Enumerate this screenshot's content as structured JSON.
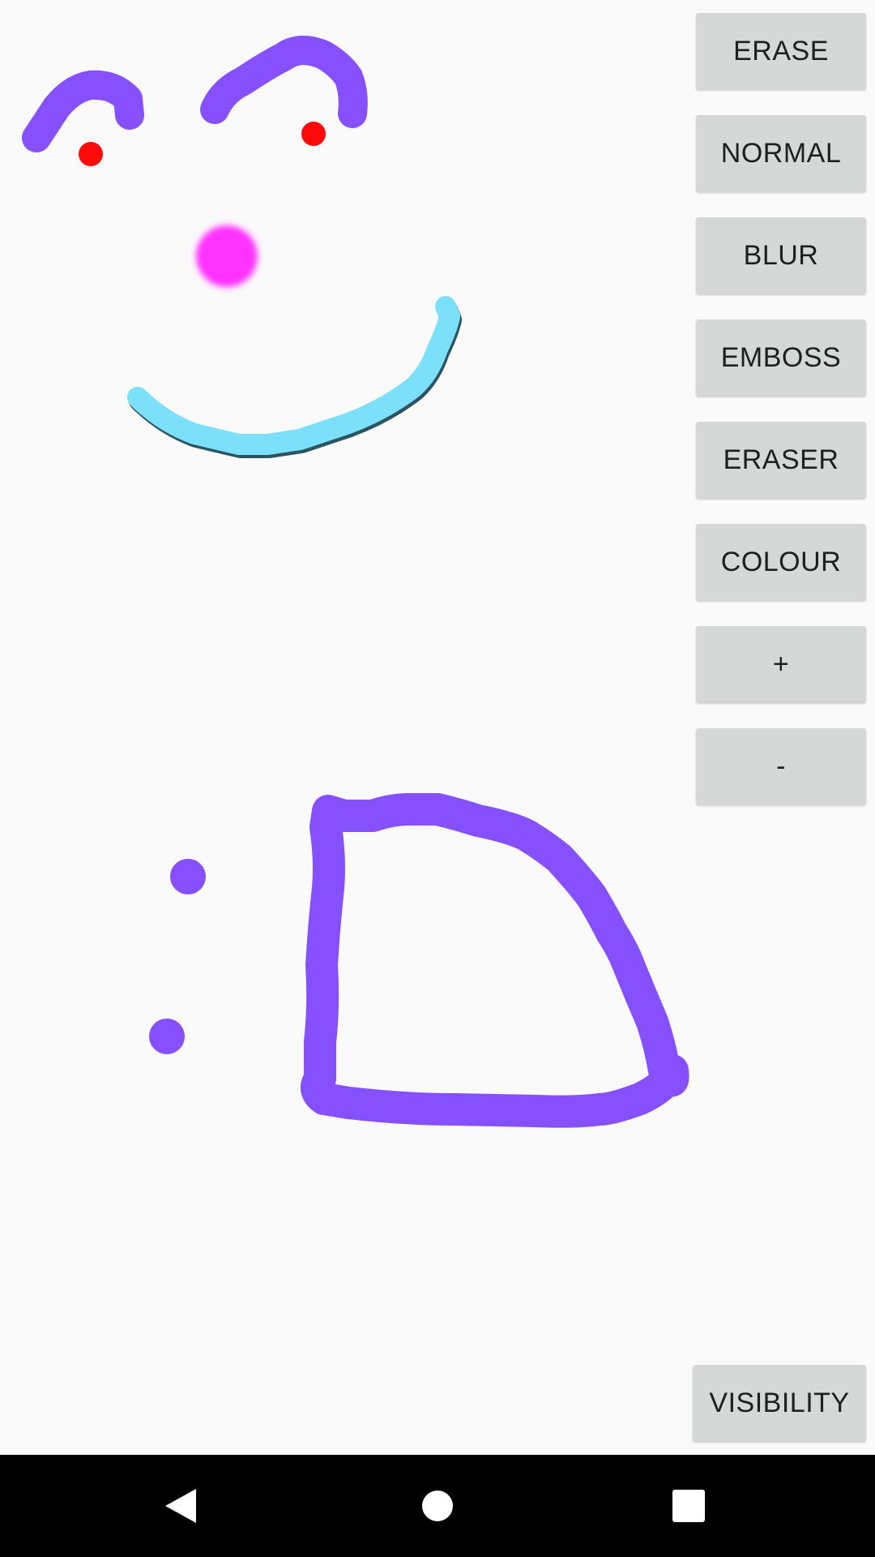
{
  "toolbar": {
    "erase_label": "ERASE",
    "normal_label": "NORMAL",
    "blur_label": "BLUR",
    "emboss_label": "EMBOSS",
    "eraser_label": "ERASER",
    "colour_label": "COLOUR",
    "increase_label": "+",
    "decrease_label": "-"
  },
  "visibility_label": "VISIBILITY",
  "canvas": {
    "stroke_colors": {
      "purple": "#8750ff",
      "red": "#ff0a0a",
      "magenta": "#ff33ff",
      "cyan": "#7de0fb"
    }
  },
  "navbar": {
    "back_icon": "back-triangle-icon",
    "home_icon": "home-circle-icon",
    "recents_icon": "recents-square-icon"
  }
}
